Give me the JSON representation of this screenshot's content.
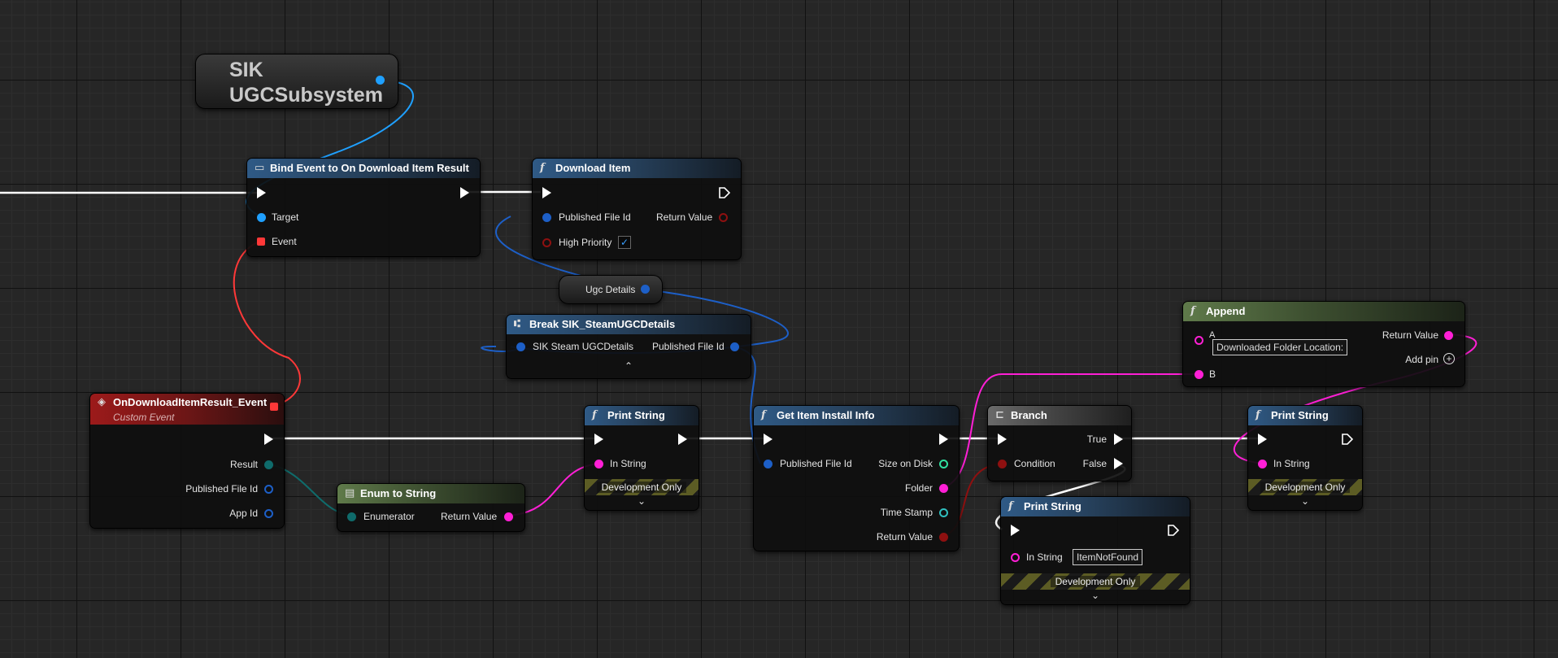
{
  "nodes": {
    "ugc_subsystem": {
      "title": "SIK UGCSubsystem"
    },
    "bind_event": {
      "title": "Bind Event to On Download Item Result",
      "target": "Target",
      "event": "Event"
    },
    "download_item": {
      "title": "Download Item",
      "published_file_id": "Published File Id",
      "return_value": "Return Value",
      "high_priority": "High Priority",
      "high_priority_checked": "✓"
    },
    "ugc_details": {
      "title": "Ugc Details"
    },
    "break_details": {
      "title": "Break SIK_SteamUGCDetails",
      "input": "SIK Steam UGCDetails",
      "output": "Published File Id",
      "expand": "⌃"
    },
    "custom_event": {
      "title": "OnDownloadItemResult_Event",
      "subtitle": "Custom Event",
      "result": "Result",
      "published_file_id": "Published File Id",
      "app_id": "App Id"
    },
    "enum_to_string": {
      "title": "Enum to String",
      "enumerator": "Enumerator",
      "return_value": "Return Value"
    },
    "print_string_1": {
      "title": "Print String",
      "in_string": "In String",
      "dev_only": "Development Only",
      "expand": "⌄"
    },
    "get_install_info": {
      "title": "Get Item Install Info",
      "published_file_id": "Published File Id",
      "size_on_disk": "Size on Disk",
      "folder": "Folder",
      "time_stamp": "Time Stamp",
      "return_value": "Return Value"
    },
    "branch": {
      "title": "Branch",
      "condition": "Condition",
      "true_label": "True",
      "false_label": "False"
    },
    "print_string_2": {
      "title": "Print String",
      "in_string": "In String",
      "in_string_value": "ItemNotFound",
      "dev_only": "Development Only",
      "expand": "⌄"
    },
    "append": {
      "title": "Append",
      "a": "A",
      "a_value": "Downloaded Folder Location:",
      "b": "B",
      "return_value": "Return Value",
      "add_pin": "Add pin"
    },
    "print_string_3": {
      "title": "Print String",
      "in_string": "In String",
      "dev_only": "Development Only",
      "expand": "⌄"
    }
  },
  "colors": {
    "exec": "#ffffff",
    "object": "#1fa0ff",
    "delegate": "#ff3838",
    "struct": "#1d5fc7",
    "string": "#ff1fd6",
    "enum": "#0f6b6b",
    "integer": "#30e0a0",
    "boolean": "#8e1010"
  },
  "icons": {
    "function": "function-icon",
    "event": "event-icon",
    "bind": "bind-event-icon",
    "break": "break-struct-icon",
    "branch": "branch-icon",
    "enum": "enum-icon",
    "add": "add-pin-icon"
  }
}
